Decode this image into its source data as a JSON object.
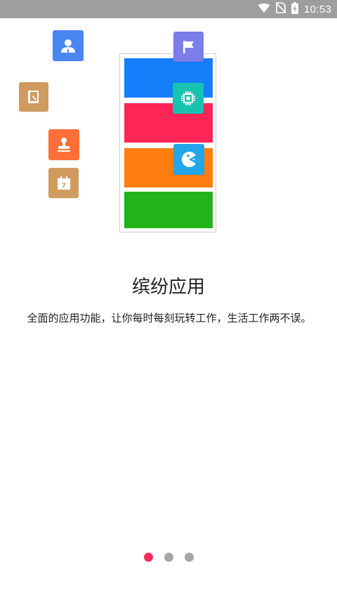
{
  "status_bar": {
    "time": "10:53",
    "icons": [
      "wifi-icon",
      "no-sim-icon",
      "battery-charging-icon"
    ]
  },
  "illustration": {
    "bands": [
      "#157efb",
      "#ff2557",
      "#ff7e10",
      "#22b31b"
    ],
    "tiles": [
      {
        "name": "contact-icon",
        "color": "#4a86f2"
      },
      {
        "name": "flag-icon",
        "color": "#7b7de9"
      },
      {
        "name": "notebook-icon",
        "color": "#cf9b5e"
      },
      {
        "name": "chip-icon",
        "color": "#17c3b0"
      },
      {
        "name": "stamp-icon",
        "color": "#ff6f37"
      },
      {
        "name": "game-icon",
        "color": "#23a5ea"
      },
      {
        "name": "calendar-icon",
        "color": "#cf9b5e",
        "day": "7"
      }
    ]
  },
  "content": {
    "title": "缤纷应用",
    "description": "全面的应用功能，让你每时每刻玩转工作，生活工作两不误。"
  },
  "pager": {
    "count": 3,
    "active_index": 0
  }
}
